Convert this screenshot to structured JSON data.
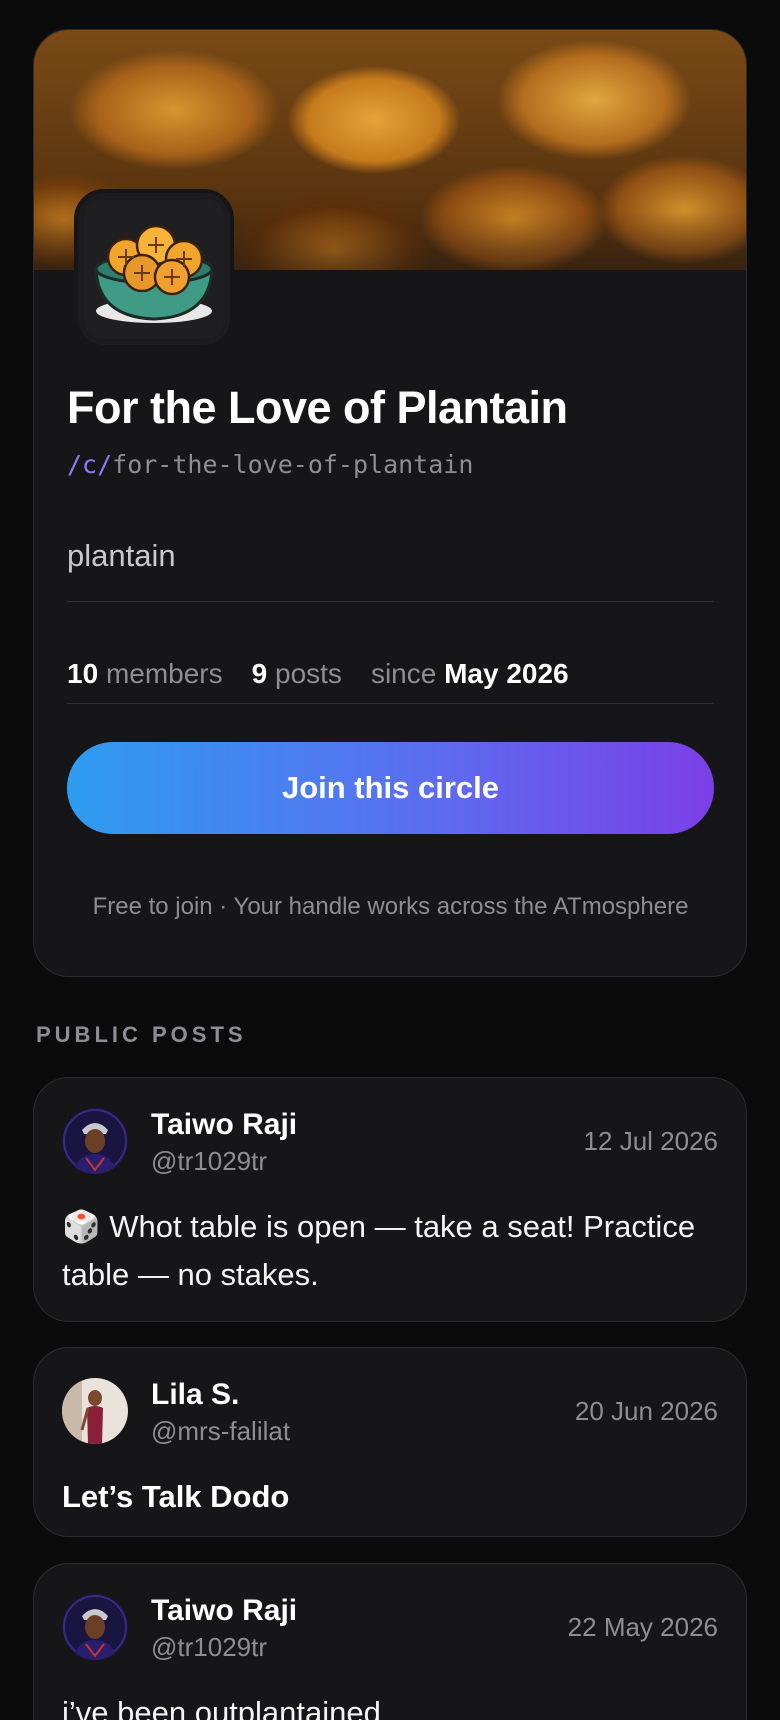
{
  "community": {
    "title": "For the Love of Plantain",
    "slug_prefix": "/c/",
    "slug": "for-the-love-of-plantain",
    "description": "plantain",
    "stats": {
      "members_count": "10",
      "members_label": "members",
      "posts_count": "9",
      "posts_label": "posts",
      "since_label": "since",
      "since_value": "May 2026"
    },
    "join_label": "Join this circle",
    "join_note": "Free to join · Your handle works across the ATmosphere"
  },
  "section_label": "PUBLIC POSTS",
  "posts": [
    {
      "author": "Taiwo Raji",
      "handle": "@tr1029tr",
      "date": "12 Jul 2026",
      "body": "🎲 Whot table is open — take a seat! Practice table — no stakes."
    },
    {
      "author": "Lila S.",
      "handle": "@mrs-falilat",
      "date": "20 Jun 2026",
      "body": "Let’s Talk Dodo"
    },
    {
      "author": "Taiwo Raji",
      "handle": "@tr1029tr",
      "date": "22 May 2026",
      "body": "i’ve been outplantained"
    }
  ],
  "colors": {
    "background": "#0b0b0c",
    "card": "#161618",
    "accent_slug": "#8b7bf4",
    "button_gradient_start": "#2e9cf0",
    "button_gradient_end": "#7b3fe8"
  },
  "icons": {
    "community_avatar": "plantain-bowl-icon",
    "post_avatar": "user-avatar"
  }
}
